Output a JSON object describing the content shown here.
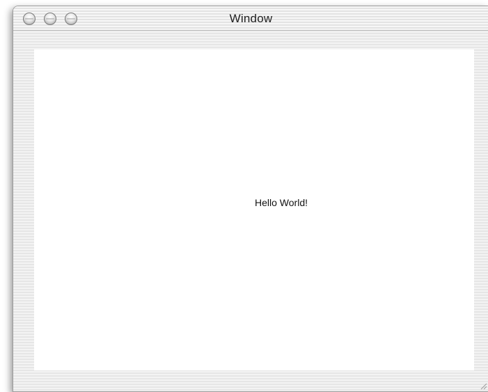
{
  "window": {
    "title": "Window",
    "content_text": "Hello World!"
  },
  "controls": {
    "close_icon": "close-icon",
    "minimize_icon": "minimize-icon",
    "zoom_icon": "zoom-icon"
  },
  "colors": {
    "content_background": "#ffffff",
    "window_background": "#ededed",
    "text": "#111111"
  }
}
